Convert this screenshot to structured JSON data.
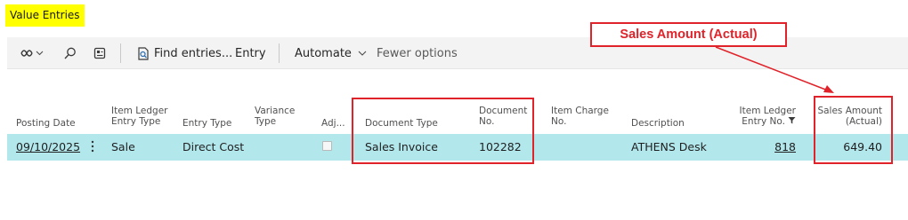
{
  "page": {
    "title": "Value Entries"
  },
  "toolbar": {
    "find_entries_label": "Find entries...",
    "entry_label": "Entry",
    "automate_label": "Automate",
    "fewer_options_label": "Fewer options"
  },
  "columns": {
    "posting_date": [
      "Posting Date"
    ],
    "item_ledger_entry_type": [
      "Item Ledger",
      "Entry Type"
    ],
    "entry_type": [
      "Entry Type"
    ],
    "variance_type": [
      "Variance",
      "Type"
    ],
    "adjusted": [
      "Adj..."
    ],
    "document_type": [
      "Document Type"
    ],
    "document_no": [
      "Document",
      "No."
    ],
    "item_charge_no": [
      "Item Charge",
      "No."
    ],
    "description": [
      "Description"
    ],
    "item_ledger_entry_no": [
      "Item Ledger",
      "Entry No."
    ],
    "sales_amount_actual": [
      "Sales Amount",
      "(Actual)"
    ]
  },
  "rows": [
    {
      "posting_date": "09/10/2025",
      "item_ledger_entry_type": "Sale",
      "entry_type": "Direct Cost",
      "variance_type": "",
      "adjusted": false,
      "document_type": "Sales Invoice",
      "document_no": "102282",
      "item_charge_no": "",
      "description": "ATHENS Desk",
      "item_ledger_entry_no": "818",
      "sales_amount_actual": "649.40"
    }
  ],
  "annotation": {
    "label": "Sales Amount (Actual)"
  },
  "colors": {
    "highlight_red": "#e0232a",
    "selected_row": "#b2e7ec",
    "title_highlight": "#ffff00"
  }
}
